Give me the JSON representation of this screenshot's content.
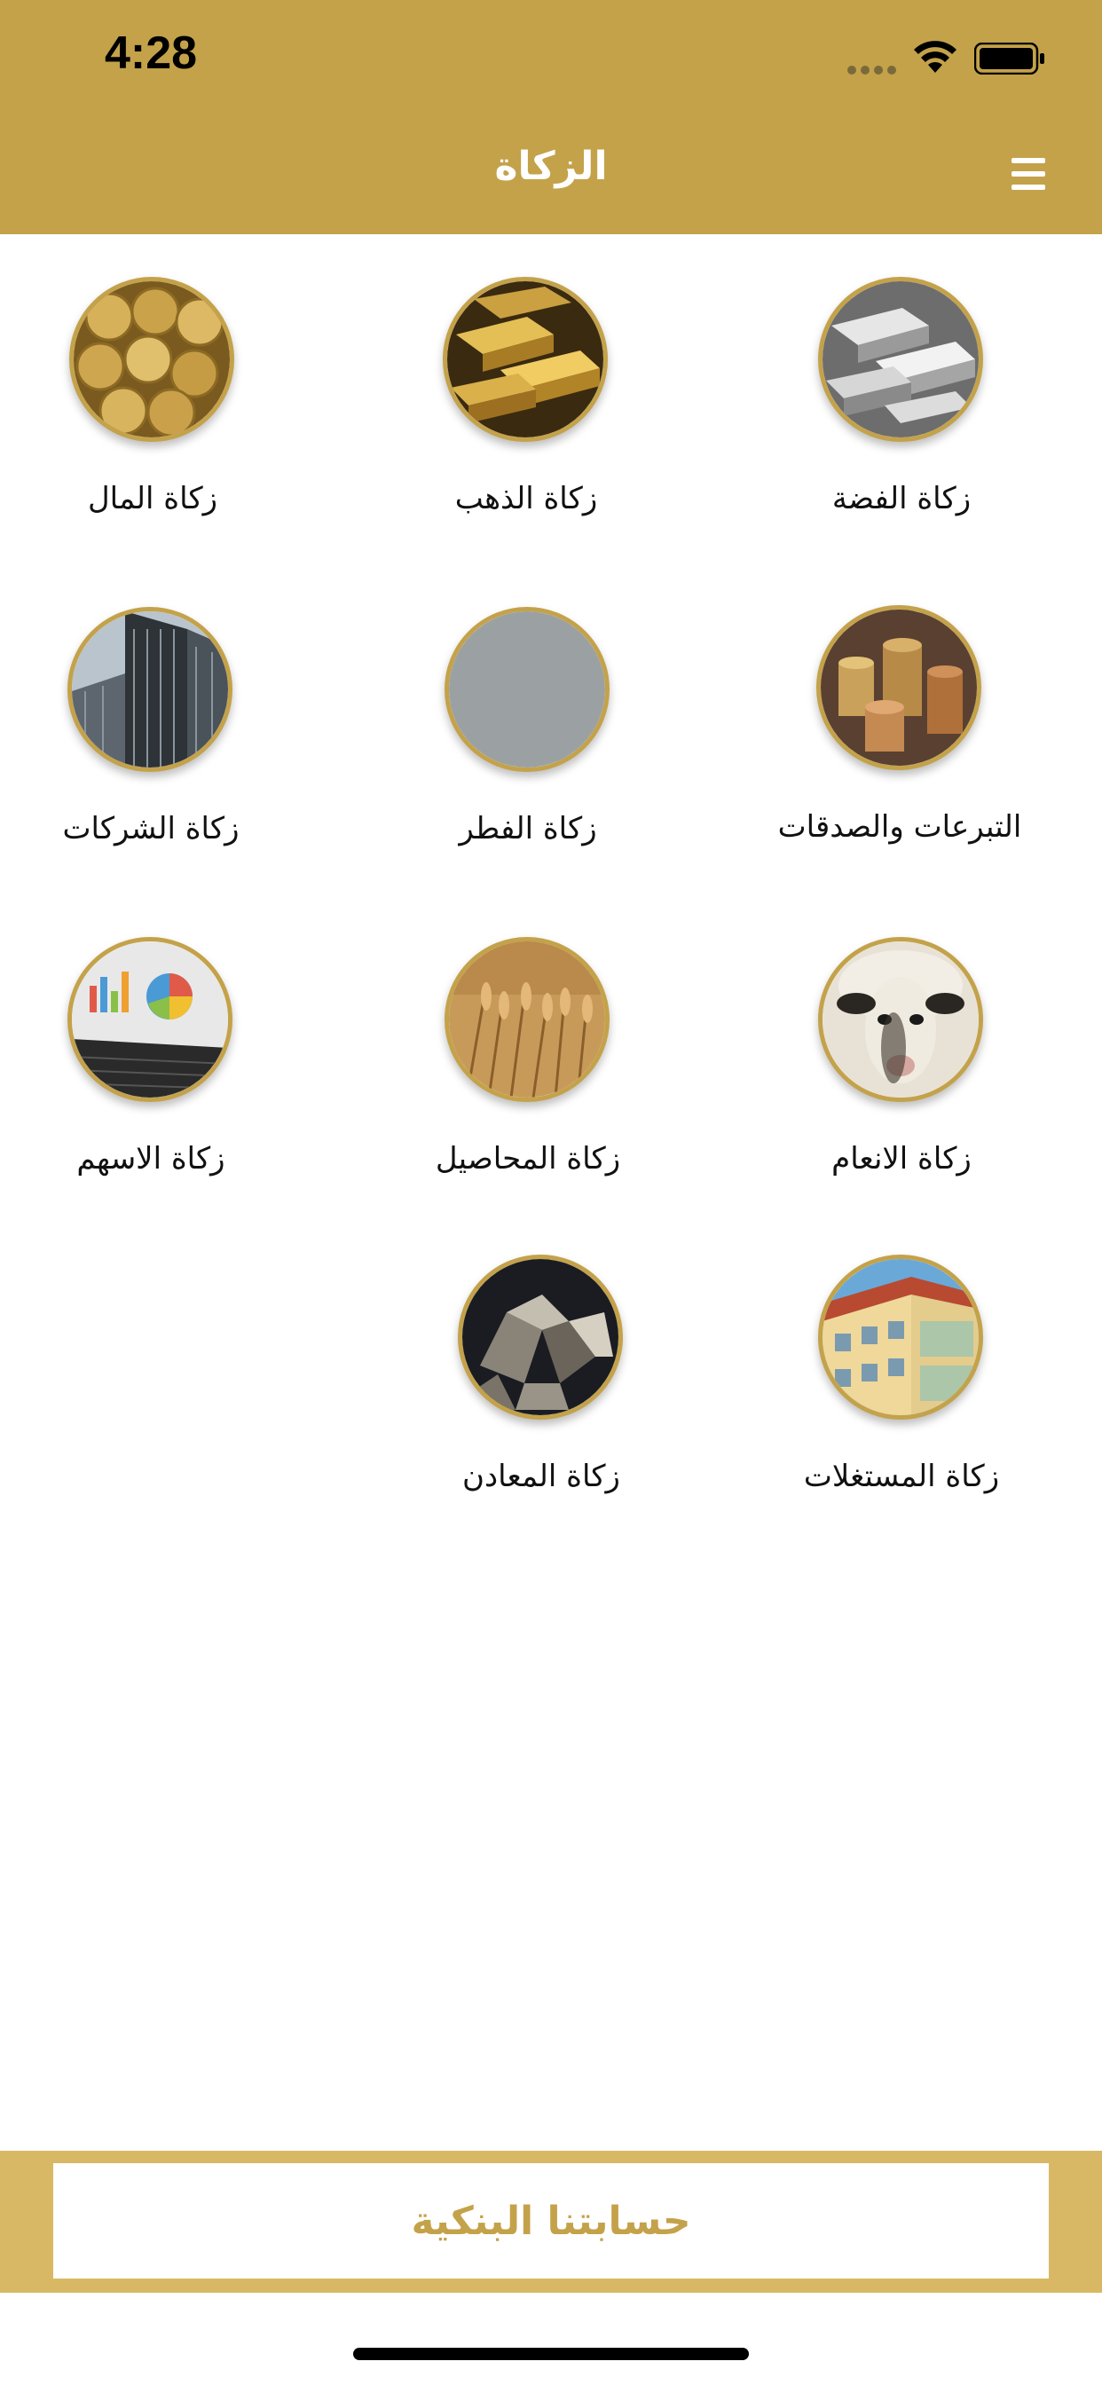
{
  "status_bar": {
    "time": "4:28"
  },
  "header": {
    "title": "الزكاة"
  },
  "items": [
    {
      "label": "زكاة المال",
      "icon": "coins-icon"
    },
    {
      "label": "زكاة الذهب",
      "icon": "gold-bars-icon"
    },
    {
      "label": "زكاة الفضة",
      "icon": "silver-bars-icon"
    },
    {
      "label": "زكاة الشركات",
      "icon": "building-icon"
    },
    {
      "label": "زكاة الفطر",
      "icon": "crescent-moon-icon"
    },
    {
      "label": "التبرعات والصدقات",
      "icon": "coin-stacks-icon"
    },
    {
      "label": "زكاة الاسهم",
      "icon": "laptop-chart-icon"
    },
    {
      "label": "زكاة المحاصيل",
      "icon": "wheat-icon"
    },
    {
      "label": "زكاة الانعام",
      "icon": "sheep-icon"
    },
    {
      "label": "زكاة المعادن",
      "icon": "minerals-icon"
    },
    {
      "label": "زكاة المستغلات",
      "icon": "apartment-icon"
    }
  ],
  "footer": {
    "button_label": "حسابتنا البنكية"
  },
  "colors": {
    "accent": "#c4a24a",
    "footer_bar": "#d9b865"
  }
}
